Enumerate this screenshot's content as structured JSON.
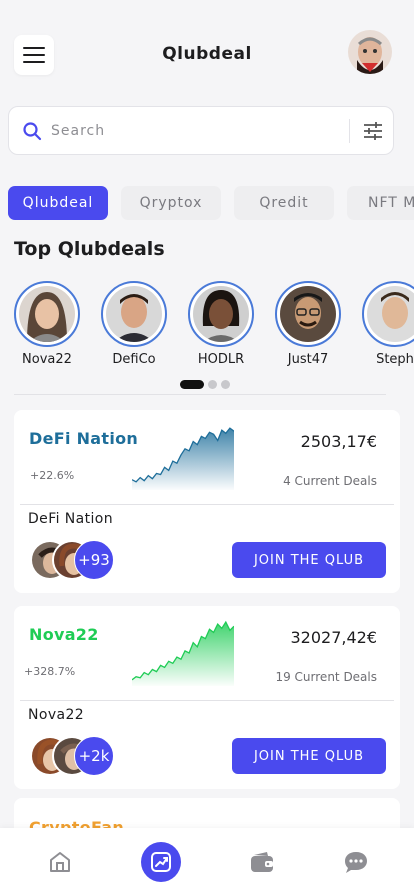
{
  "header": {
    "title": "Qlubdeal"
  },
  "search": {
    "placeholder": "Search"
  },
  "tabs": [
    {
      "label": "Qlubdeal",
      "active": true
    },
    {
      "label": "Qryptox",
      "active": false
    },
    {
      "label": "Qredit",
      "active": false
    },
    {
      "label": "NFT Ma",
      "active": false
    }
  ],
  "top_section": {
    "title": "Top Qlubdeals"
  },
  "people": [
    {
      "name": "Nova22"
    },
    {
      "name": "DefiCo"
    },
    {
      "name": "HODLR"
    },
    {
      "name": "Just47"
    },
    {
      "name": "Steph"
    }
  ],
  "carousel": {
    "pages": 3,
    "active": 0
  },
  "cards": [
    {
      "name": "DeFi Nation",
      "name_color": "#1e6e9a",
      "change": "+22.6%",
      "value": "2503,17€",
      "deals": "4 Current Deals",
      "label": "DeFi Nation",
      "member_count": "+93",
      "join_label": "JOIN THE QLUB",
      "spark_color": "#1e6e9a",
      "spark": [
        10,
        8,
        12,
        9,
        14,
        11,
        16,
        15,
        22,
        19,
        28,
        26,
        34,
        40,
        38,
        47,
        44,
        52,
        50,
        56,
        54,
        48,
        58,
        55,
        60,
        57
      ]
    },
    {
      "name": "Nova22",
      "name_color": "#1fcc55",
      "change": "+328.7%",
      "value": "32027,42€",
      "deals": "19 Current Deals",
      "label": "Nova22",
      "member_count": "+2k",
      "join_label": "JOIN THE QLUB",
      "spark_color": "#1fcc55",
      "spark": [
        6,
        9,
        8,
        13,
        11,
        16,
        14,
        20,
        18,
        24,
        22,
        28,
        26,
        34,
        32,
        42,
        38,
        48,
        46,
        55,
        52,
        60,
        56,
        62,
        54,
        58
      ]
    }
  ],
  "partial_card": {
    "name": "CryptoFan",
    "name_color": "#f0a030"
  },
  "nav": [
    {
      "icon": "home-icon",
      "active": false
    },
    {
      "icon": "chart-icon",
      "active": true
    },
    {
      "icon": "wallet-icon",
      "active": false
    },
    {
      "icon": "chat-icon",
      "active": false
    }
  ],
  "colors": {
    "accent": "#4a4aee",
    "ring": "#4a7ad8"
  }
}
